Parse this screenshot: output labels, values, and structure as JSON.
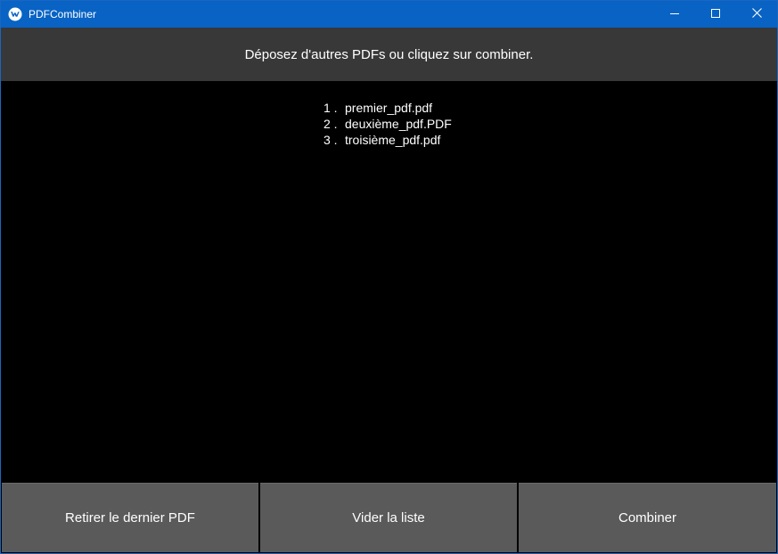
{
  "window": {
    "title": "PDFCombiner",
    "accent_color": "#0863c4",
    "app_icon": "kivy-logo-icon",
    "controls": {
      "minimize_icon": "minimize-icon",
      "maximize_icon": "maximize-icon",
      "close_icon": "close-icon"
    }
  },
  "header": {
    "message": "Déposez d'autres PDFs ou cliquez sur combiner."
  },
  "file_list": {
    "items": [
      {
        "number": "1 .",
        "name": "premier_pdf.pdf"
      },
      {
        "number": "2 .",
        "name": "deuxième_pdf.PDF"
      },
      {
        "number": "3 .",
        "name": "troisième_pdf.pdf"
      }
    ]
  },
  "actions": {
    "remove_last_label": "Retirer le dernier PDF",
    "clear_list_label": "Vider la liste",
    "combine_label": "Combiner"
  }
}
